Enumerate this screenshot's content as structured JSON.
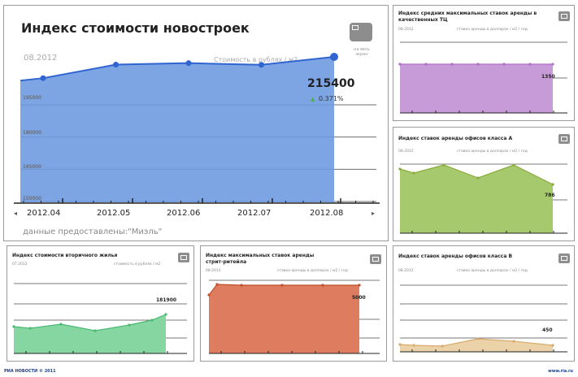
{
  "main": {
    "title": "Индекс стоимости новостроек",
    "date": "08.2012",
    "unit": "Стоимость в рублях / м2",
    "fullscreen_label": "на весь экран",
    "value": "215400",
    "change": "0.371%",
    "source": "данные предоставлены:\"Миэль\"",
    "tick_labels": [
      "150000",
      "165000",
      "180000",
      "195000"
    ],
    "nav_prev": "◂",
    "nav_next": "▸"
  },
  "mini_charts": [
    {
      "id": "retail",
      "title": "Индекс средних максимальных ставок аренды в качественных ТЦ",
      "date": "08.2012",
      "unit": "ставка аренды в долларах / м2 / год",
      "value": "1350",
      "color": "#c79ad8"
    },
    {
      "id": "officeA",
      "title": "Индекс ставок аренды офисов класса А",
      "date": "08.2012",
      "unit": "ставка аренды в долларах / м2 / год",
      "value": "786",
      "color": "#a7c96e"
    },
    {
      "id": "secondary",
      "title": "Индекс стоимости вторичного жилья",
      "date": "07.2012",
      "unit": "стоимость в рублях / м2",
      "value": "181900",
      "color": "#86d6a1"
    },
    {
      "id": "street",
      "title": "Индекс максимальных ставок аренды стрит-ритейла",
      "date": "08.2012",
      "unit": "ставка аренды в долларах / м2 / год",
      "value": "5000",
      "color": "#dd7c5e"
    },
    {
      "id": "officeB",
      "title": "Индекс ставок аренды офисов класса В",
      "date": "08.2012",
      "unit": "ставка аренды в долларах / м2 / год",
      "value": "450",
      "color": "#ecd2a8"
    }
  ],
  "footer": {
    "brand": "РИА НОВОСТИ © 2011",
    "url": "www.ria.ru"
  },
  "chart_data": [
    {
      "type": "area",
      "title": "Индекс стоимости новостроек",
      "x": [
        "2012.04",
        "2012.05",
        "2012.06",
        "2012.07",
        "2012.08"
      ],
      "series": [
        {
          "values": [
            205500,
            211800,
            212500,
            211700,
            215400
          ]
        }
      ],
      "ylim": [
        150000,
        215400
      ],
      "yticks": [
        150000,
        165000,
        180000,
        195000
      ],
      "color": "#6f9ae0"
    }
  ]
}
